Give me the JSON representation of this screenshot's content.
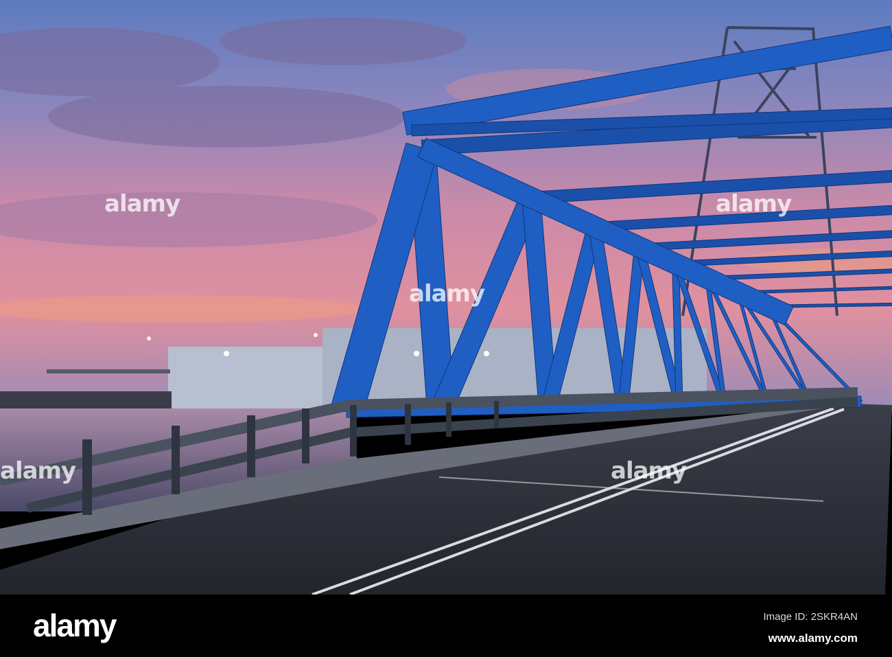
{
  "watermark": {
    "text": "alamy"
  },
  "footer": {
    "logo": "alamy",
    "image_id": "Image ID: 2SKR4AN",
    "url": "www.alamy.com"
  },
  "colors": {
    "bridge": "#1f5fc4",
    "sky_top": "#6f8cc8",
    "sky_pink": "#d98aa8",
    "road": "#2c3038"
  }
}
